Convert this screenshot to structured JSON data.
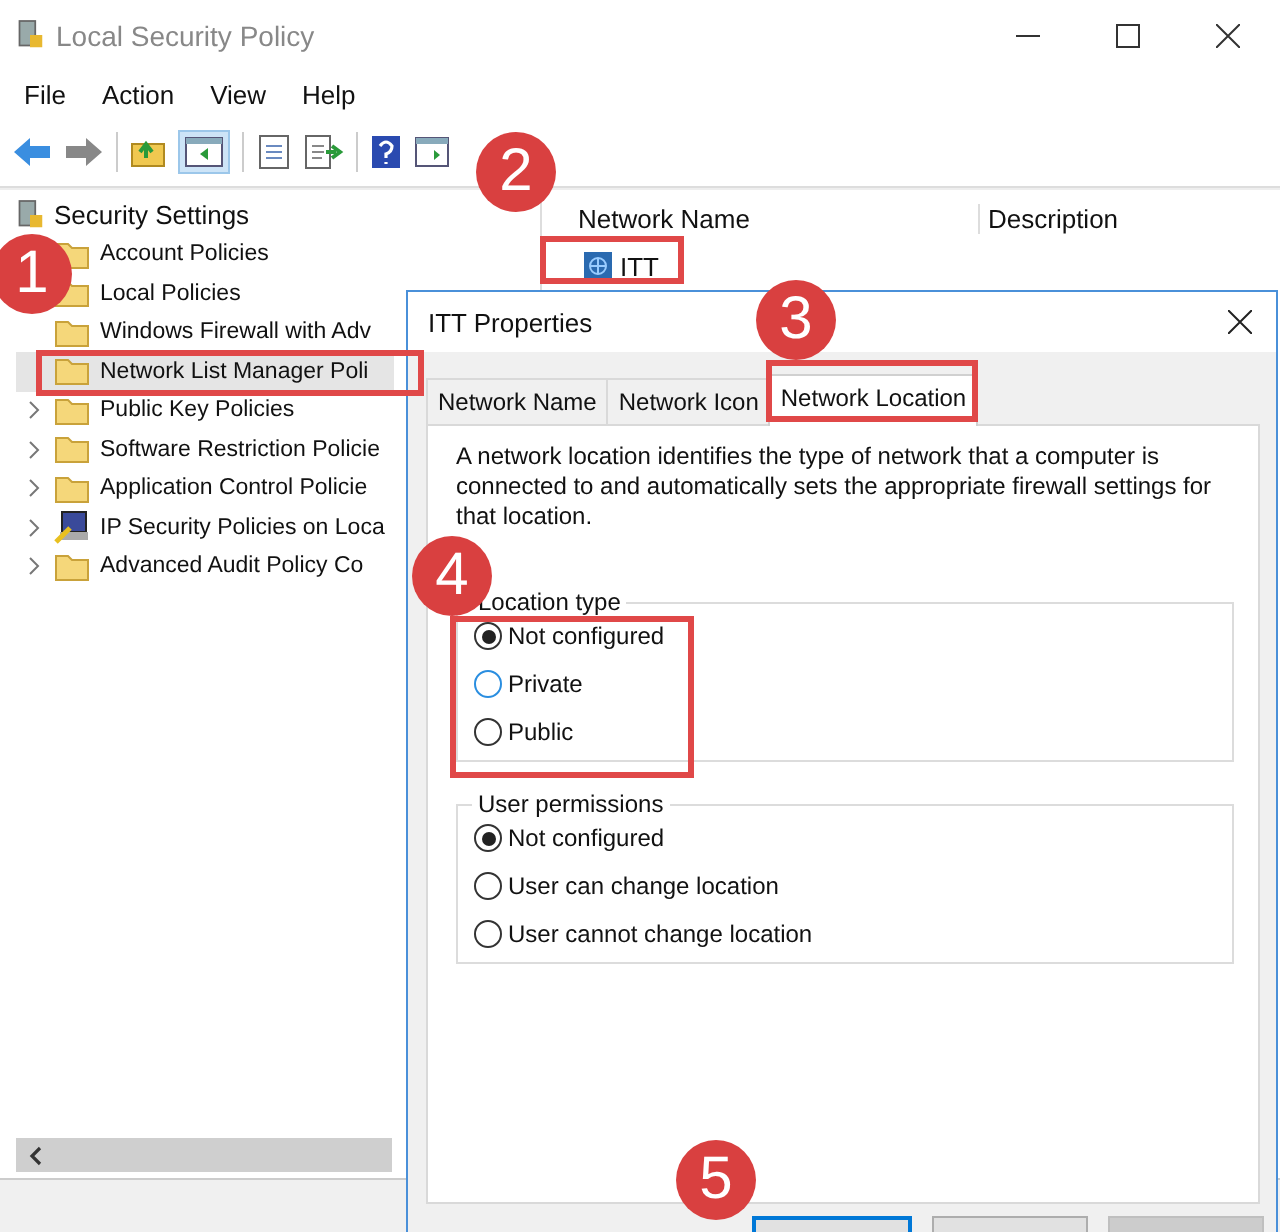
{
  "window": {
    "title": "Local Security Policy"
  },
  "menu": [
    "File",
    "Action",
    "View",
    "Help"
  ],
  "tree": {
    "label": "Security Settings",
    "children": [
      {
        "label": "Account Policies",
        "kind": "folder",
        "selected": false
      },
      {
        "label": "Local Policies",
        "kind": "folder",
        "selected": false
      },
      {
        "label": "Windows Firewall with Adv",
        "kind": "folder",
        "expandable": false,
        "selected": false
      },
      {
        "label": "Network List Manager Poli",
        "kind": "folder",
        "expandable": false,
        "selected": true
      },
      {
        "label": "Public Key Policies",
        "kind": "folder",
        "expandable": true,
        "selected": false
      },
      {
        "label": "Software Restriction Policie",
        "kind": "folder",
        "expandable": true,
        "selected": false
      },
      {
        "label": "Application Control Policie",
        "kind": "folder",
        "expandable": true,
        "selected": false
      },
      {
        "label": "IP Security Policies on Loca",
        "kind": "ipsec",
        "expandable": true,
        "selected": false
      },
      {
        "label": "Advanced Audit Policy Co",
        "kind": "folder",
        "expandable": true,
        "selected": false
      }
    ]
  },
  "list": {
    "columns": [
      "Network Name",
      "Description"
    ],
    "rows": [
      {
        "name": "ITT"
      }
    ]
  },
  "dialog": {
    "title": "ITT Properties",
    "tabs": [
      {
        "label": "Network Name",
        "selected": false
      },
      {
        "label": "Network Icon",
        "selected": false
      },
      {
        "label": "Network Location",
        "selected": true
      }
    ],
    "description": "A network location identifies the type of network that a computer is connected to and automatically sets the appropriate firewall settings for that location.",
    "groups": [
      {
        "title": "Location type",
        "options": [
          {
            "label": "Not configured",
            "selected": true
          },
          {
            "label": "Private",
            "selected": false
          },
          {
            "label": "Public",
            "selected": false
          }
        ]
      },
      {
        "title": "User permissions",
        "options": [
          {
            "label": "Not configured",
            "selected": true
          },
          {
            "label": "User can change location",
            "selected": false
          },
          {
            "label": "User cannot change location",
            "selected": false
          }
        ]
      }
    ]
  },
  "callouts": [
    "1",
    "2",
    "3",
    "4",
    "5"
  ]
}
